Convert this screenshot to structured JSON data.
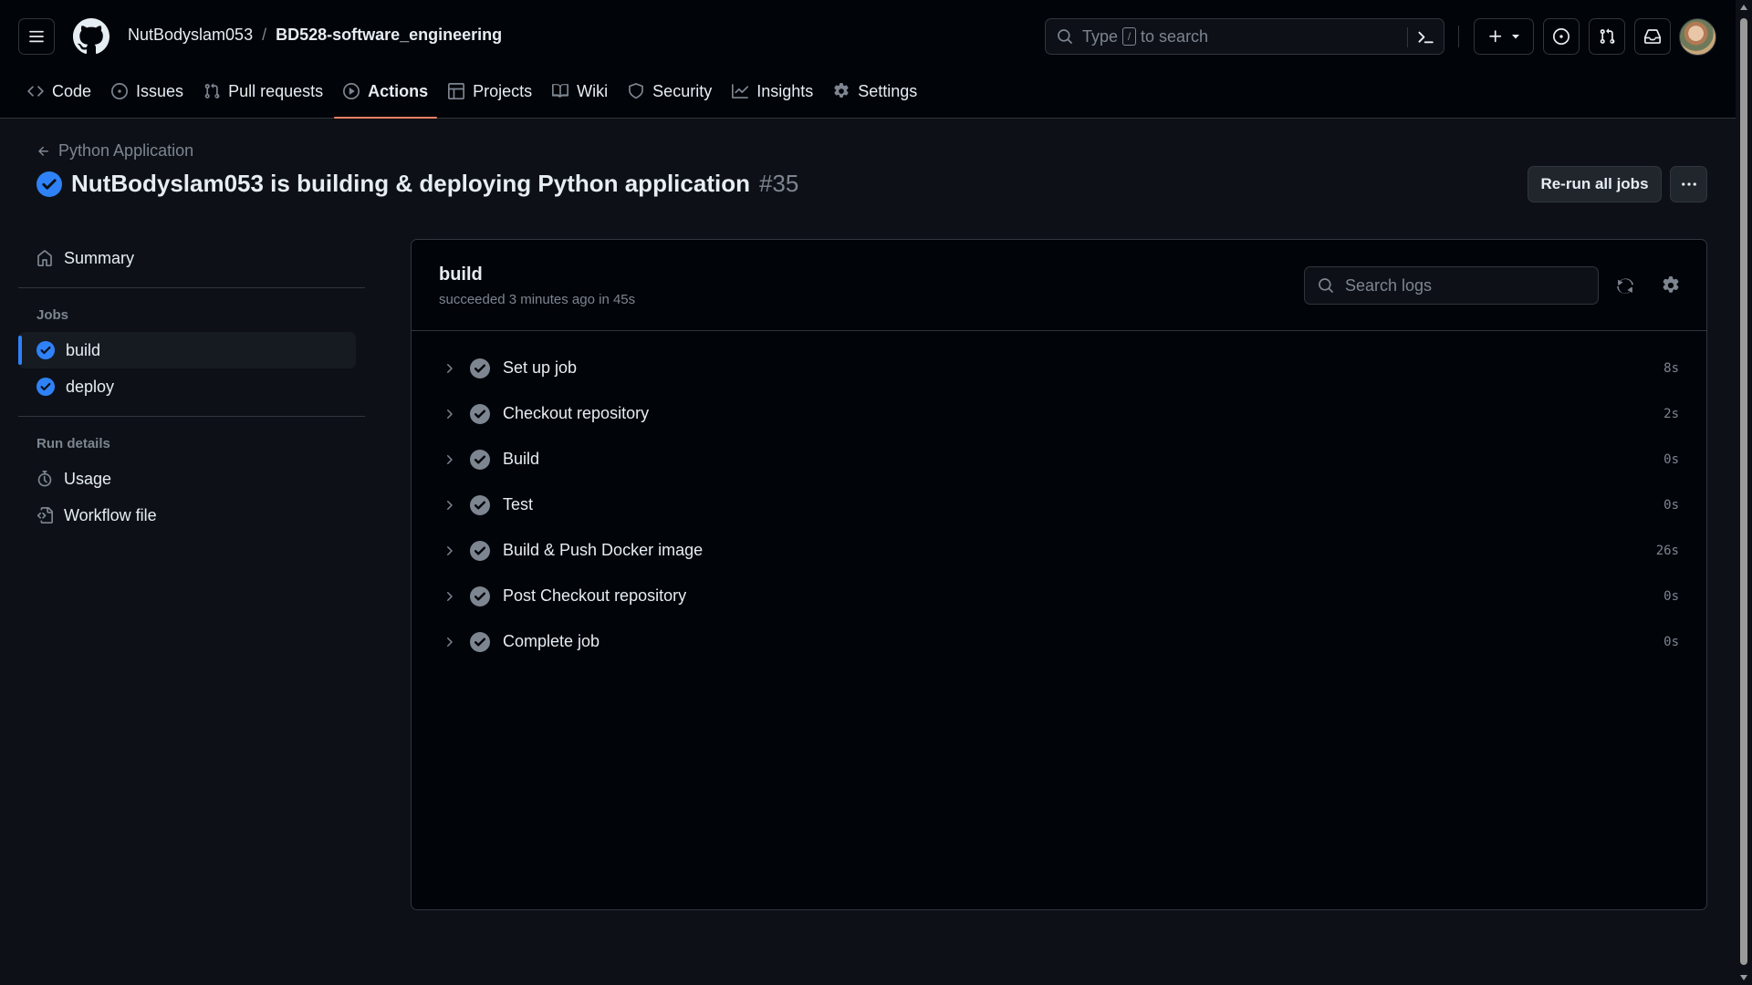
{
  "header": {
    "owner": "NutBodyslam053",
    "separator": "/",
    "repo": "BD528-software_engineering",
    "search": {
      "prefix": "Type",
      "key": "/",
      "suffix": "to search"
    }
  },
  "tabs": [
    {
      "label": "Code",
      "icon": "code-icon"
    },
    {
      "label": "Issues",
      "icon": "issue-icon"
    },
    {
      "label": "Pull requests",
      "icon": "pull-request-icon"
    },
    {
      "label": "Actions",
      "icon": "play-icon",
      "active": true
    },
    {
      "label": "Projects",
      "icon": "table-icon"
    },
    {
      "label": "Wiki",
      "icon": "book-icon"
    },
    {
      "label": "Security",
      "icon": "shield-icon"
    },
    {
      "label": "Insights",
      "icon": "graph-icon"
    },
    {
      "label": "Settings",
      "icon": "gear-icon"
    }
  ],
  "run": {
    "back_label": "Python Application",
    "title": "NutBodyslam053 is building & deploying Python application",
    "number": "#35",
    "rerun_label": "Re-run all jobs"
  },
  "sidebar": {
    "summary": "Summary",
    "jobs_heading": "Jobs",
    "jobs": [
      {
        "label": "build",
        "selected": true
      },
      {
        "label": "deploy",
        "selected": false
      }
    ],
    "details_heading": "Run details",
    "details": [
      {
        "label": "Usage",
        "icon": "stopwatch-icon"
      },
      {
        "label": "Workflow file",
        "icon": "file-code-icon"
      }
    ]
  },
  "job": {
    "name": "build",
    "meta": "succeeded 3 minutes ago in 45s",
    "search_placeholder": "Search logs",
    "steps": [
      {
        "label": "Set up job",
        "duration": "8s"
      },
      {
        "label": "Checkout repository",
        "duration": "2s"
      },
      {
        "label": "Build",
        "duration": "0s"
      },
      {
        "label": "Test",
        "duration": "0s"
      },
      {
        "label": "Build & Push Docker image",
        "duration": "26s"
      },
      {
        "label": "Post Checkout repository",
        "duration": "0s"
      },
      {
        "label": "Complete job",
        "duration": "0s"
      }
    ]
  },
  "colors": {
    "background": "#0d1117",
    "header_bg": "#010409",
    "border": "#30363d",
    "muted": "#7d8590",
    "success_blue": "#2f81f7",
    "step_ok_gray": "#7d8590",
    "tab_underline": "#f78166"
  }
}
